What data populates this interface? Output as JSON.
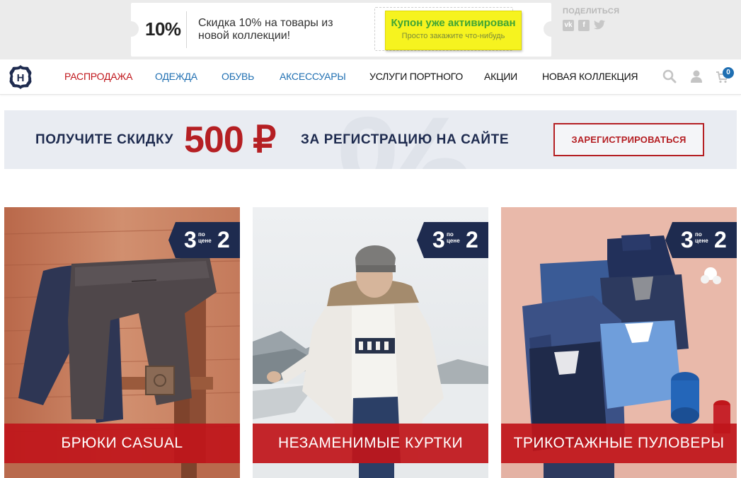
{
  "coupon": {
    "percent": "10%",
    "description": "Скидка 10% на товары из новой коллекции!",
    "button_title": "Купон уже активирован",
    "button_subtitle": "Просто закажите что-нибудь"
  },
  "share": {
    "label": "ПОДЕЛИТЬСЯ",
    "icons": [
      "vk-icon",
      "facebook-icon",
      "twitter-icon"
    ]
  },
  "nav": {
    "items": [
      {
        "label": "РАСПРОДАЖА",
        "color": "#c0161b"
      },
      {
        "label": "ОДЕЖДА",
        "color": "#1f6fb2"
      },
      {
        "label": "ОБУВЬ",
        "color": "#1f6fb2"
      },
      {
        "label": "АКСЕССУАРЫ",
        "color": "#1f6fb2"
      },
      {
        "label": "УСЛУГИ ПОРТНОГО",
        "color": "#111111"
      },
      {
        "label": "АКЦИИ",
        "color": "#111111"
      },
      {
        "label": "НОВАЯ КОЛЛЕКЦИЯ",
        "color": "#111111"
      }
    ],
    "cart_count": "0"
  },
  "banner": {
    "text_left": "ПОЛУЧИТЕ СКИДКУ",
    "amount": "500 ₽",
    "text_right": "ЗА РЕГИСТРАЦИЮ НА САЙТЕ",
    "button": "ЗАРЕГИСТРИРОВАТЬСЯ"
  },
  "cards": [
    {
      "caption": "БРЮКИ CASUAL",
      "promo_big_left": "3",
      "promo_small": "по цене",
      "promo_big_right": "2"
    },
    {
      "caption": "НЕЗАМЕНИМЫЕ КУРТКИ",
      "promo_big_left": "3",
      "promo_small": "по цене",
      "promo_big_right": "2"
    },
    {
      "caption": "ТРИКОТАЖНЫЕ ПУЛОВЕРЫ",
      "promo_big_left": "3",
      "promo_small": "по цене",
      "promo_big_right": "2"
    }
  ],
  "colors": {
    "accent_red": "#c0161b",
    "accent_blue": "#1f6fb2",
    "navy": "#1e2b4f",
    "coupon_yellow": "#f6f31f"
  }
}
